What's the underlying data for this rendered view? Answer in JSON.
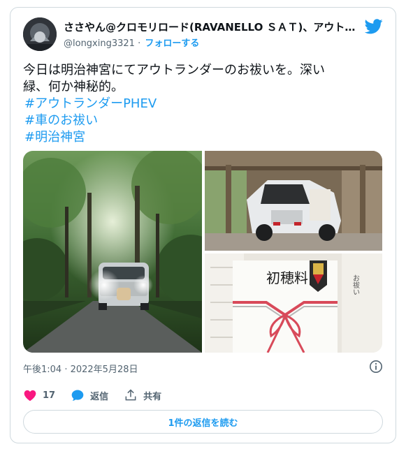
{
  "author": {
    "display_name": "ささやん@クロモリロード(RAVANELLO ＳＡＴ)、アウトランダー",
    "handle": "@longxing3321",
    "separator": "·",
    "follow_label": "フォローする"
  },
  "tweet": {
    "lines": [
      "今日は明治神宮にてアウトランダーのお祓いを。深い",
      "緑、何か神秘的。"
    ],
    "hashtags": [
      "#アウトランダーPHEV",
      "#車のお祓い",
      "#明治神宮"
    ],
    "timestamp": "午後1:04 · 2022年5月28日"
  },
  "media": {
    "photo_count": 3,
    "envelope_text": "初穂料"
  },
  "actions": {
    "like_count": "17",
    "reply_label": "返信",
    "share_label": "共有"
  },
  "read_replies_label": "1件の返信を読む",
  "colors": {
    "accent": "#1d9bf0",
    "like": "#f91880",
    "text": "#0f1419",
    "muted": "#536471",
    "border": "#cfd9de"
  }
}
